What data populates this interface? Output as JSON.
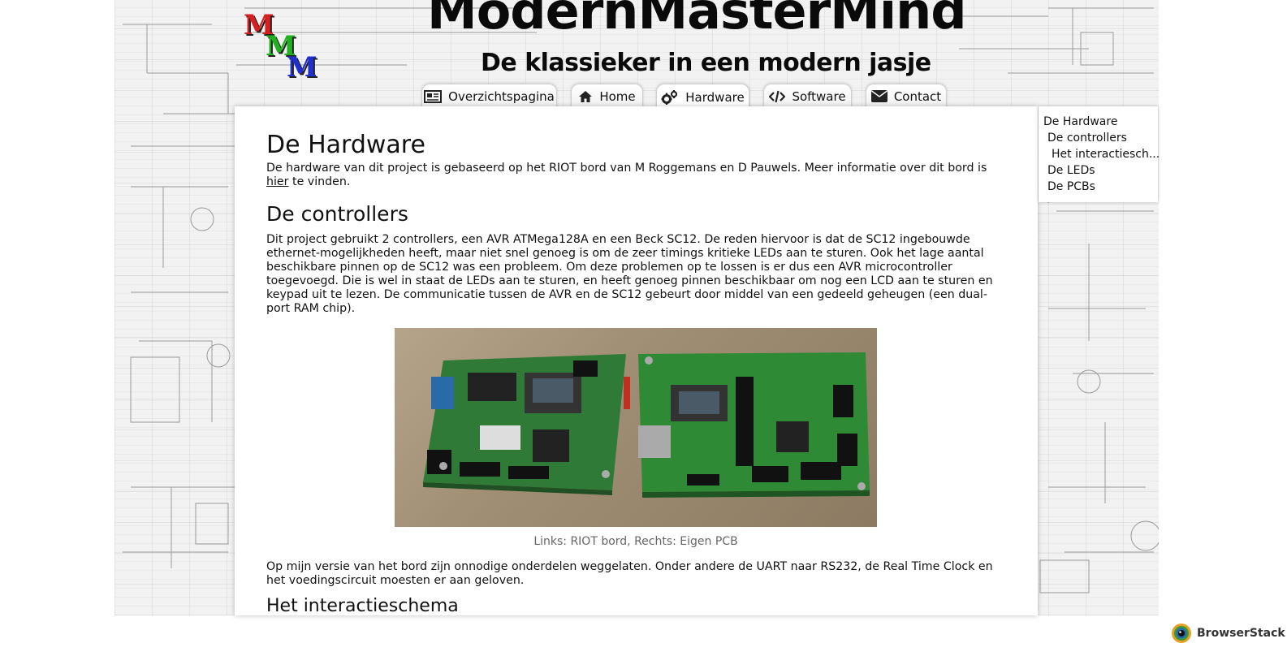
{
  "logo": {
    "letters": [
      "M",
      "M",
      "M"
    ],
    "colors": [
      "#d62020",
      "#20b020",
      "#2030d0"
    ]
  },
  "header": {
    "title": "ModernMasterMind",
    "subtitle": "De klassieker in een modern jasje"
  },
  "nav": {
    "tabs": [
      {
        "label": "Overzichtspagina",
        "icon": "newspaper-icon"
      },
      {
        "label": "Home",
        "icon": "home-icon"
      },
      {
        "label": "Hardware",
        "icon": "gears-icon",
        "active": true
      },
      {
        "label": "Software",
        "icon": "code-icon"
      },
      {
        "label": "Contact",
        "icon": "envelope-icon"
      }
    ]
  },
  "main": {
    "title": "De Hardware",
    "intro_before_link": "De hardware van dit project is gebaseerd op het RIOT bord van M Roggemans en D Pauwels. Meer informatie over dit bord is ",
    "intro_link": "hier",
    "intro_after_link": " te vinden.",
    "controllers_heading": "De controllers",
    "controllers_text": "Dit project gebruikt 2 controllers, een AVR ATMega128A en een Beck SC12. De reden hiervoor is dat de SC12 ingebouwde ethernet-mogelijkheden heeft, maar niet snel genoeg is om de zeer timings kritieke LEDs aan te sturen. Ook het lage aantal beschikbare pinnen op de SC12 was een probleem. Om deze problemen op te lossen is er dus een AVR microcontroller toegevoegd. Die is wel in staat de LEDs aan te sturen, en heeft genoeg pinnen beschikbaar om nog een LCD aan te sturen en keypad uit te lezen. De communicatie tussen de AVR en de SC12 gebeurt door middel van een gedeeld geheugen (een dual-port RAM chip).",
    "photo_caption": "Links: RIOT bord, Rechts: Eigen PCB",
    "version_text": "Op mijn versie van het bord zijn onnodige onderdelen weggelaten. Onder andere de UART naar RS232, de Real Time Clock en het voedingscircuit moesten er aan geloven.",
    "interaction_heading": "Het interactieschema"
  },
  "toc": {
    "items": [
      {
        "label": "De Hardware",
        "level": 0
      },
      {
        "label": "De controllers",
        "level": 1
      },
      {
        "label": "Het interactiesch...",
        "level": 2
      },
      {
        "label": "De LEDs",
        "level": 1
      },
      {
        "label": "De PCBs",
        "level": 1
      }
    ]
  },
  "badge": {
    "label": "BrowserStack"
  }
}
